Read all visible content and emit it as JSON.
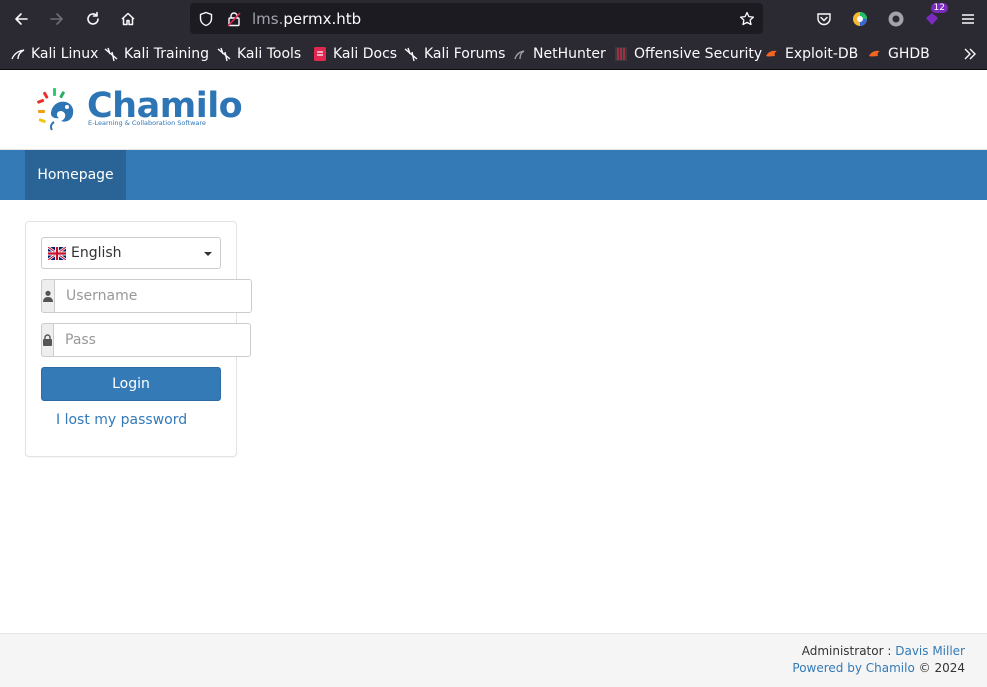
{
  "browser": {
    "url_dim": "lms.",
    "url_main": "permx.htb",
    "extension_badge": "12",
    "colors": {
      "toolbar": "#2b2a33",
      "urlbar": "#1c1b22",
      "text": "#fbfbfe"
    }
  },
  "bookmarks": [
    {
      "label": "Kali Linux",
      "icon": "kali-dragon-icon"
    },
    {
      "label": "Kali Training",
      "icon": "kali-dragon-icon"
    },
    {
      "label": "Kali Tools",
      "icon": "kali-dragon-icon"
    },
    {
      "label": "Kali Docs",
      "icon": "kali-docs-icon"
    },
    {
      "label": "Kali Forums",
      "icon": "kali-dragon-icon"
    },
    {
      "label": "NetHunter",
      "icon": "nethunter-icon"
    },
    {
      "label": "Offensive Security",
      "icon": "offsec-icon"
    },
    {
      "label": "Exploit-DB",
      "icon": "exploitdb-icon"
    },
    {
      "label": "GHDB",
      "icon": "ghdb-icon"
    }
  ],
  "site": {
    "logo_text": "Chamilo",
    "logo_tagline": "E-Learning & Collaboration Software",
    "nav": {
      "home": "Homepage"
    },
    "colors": {
      "primary": "#337ab7",
      "nav_active": "#2a6496"
    }
  },
  "login": {
    "language": "English",
    "username_placeholder": "Username",
    "password_placeholder": "Pass",
    "login_label": "Login",
    "lost_password": "I lost my password"
  },
  "footer": {
    "admin_label": "Administrator :",
    "admin_name": "Davis Miller",
    "powered_by": "Powered by Chamilo",
    "copyright": "© 2024"
  }
}
